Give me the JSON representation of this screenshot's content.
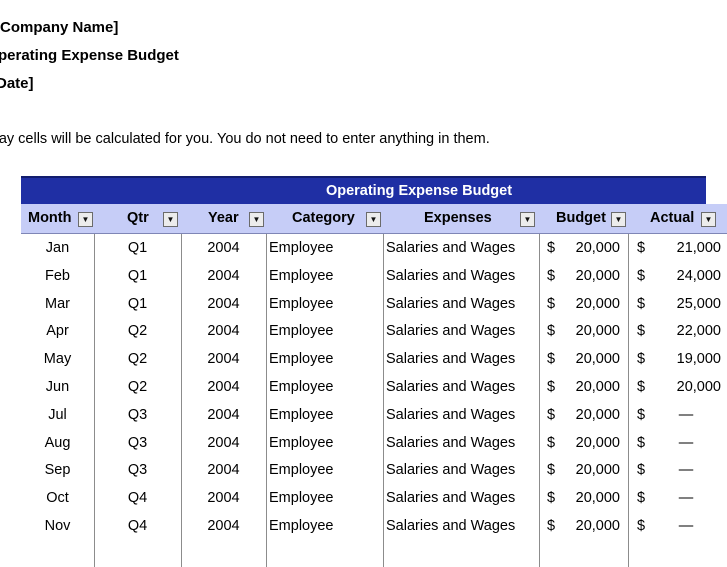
{
  "header": {
    "company": "Company Name]",
    "title": "perating Expense Budget",
    "date": "Date]"
  },
  "note": "ray cells will be calculated for you. You do not need to enter anything in them.",
  "table": {
    "banner": "Operating Expense Budget",
    "columns": [
      {
        "label": "Month",
        "dropdown": "▼"
      },
      {
        "label": "Qtr",
        "dropdown": "▼"
      },
      {
        "label": "Year",
        "dropdown": "▼"
      },
      {
        "label": "Category",
        "dropdown": "▼"
      },
      {
        "label": "Expenses",
        "dropdown": "▼"
      },
      {
        "label": "Budget",
        "dropdown": "▼"
      },
      {
        "label": "Actual",
        "dropdown": "▼"
      }
    ],
    "currency_symbol": "$",
    "rows": [
      {
        "month": "Jan",
        "qtr": "Q1",
        "year": "2004",
        "category": "Employee",
        "expenses": "Salaries and Wages",
        "budget": "20,000",
        "actual": "21,000"
      },
      {
        "month": "Feb",
        "qtr": "Q1",
        "year": "2004",
        "category": "Employee",
        "expenses": "Salaries and Wages",
        "budget": "20,000",
        "actual": "24,000"
      },
      {
        "month": "Mar",
        "qtr": "Q1",
        "year": "2004",
        "category": "Employee",
        "expenses": "Salaries and Wages",
        "budget": "20,000",
        "actual": "25,000"
      },
      {
        "month": "Apr",
        "qtr": "Q2",
        "year": "2004",
        "category": "Employee",
        "expenses": "Salaries and Wages",
        "budget": "20,000",
        "actual": "22,000"
      },
      {
        "month": "May",
        "qtr": "Q2",
        "year": "2004",
        "category": "Employee",
        "expenses": "Salaries and Wages",
        "budget": "20,000",
        "actual": "19,000"
      },
      {
        "month": "Jun",
        "qtr": "Q2",
        "year": "2004",
        "category": "Employee",
        "expenses": "Salaries and Wages",
        "budget": "20,000",
        "actual": "20,000"
      },
      {
        "month": "Jul",
        "qtr": "Q3",
        "year": "2004",
        "category": "Employee",
        "expenses": "Salaries and Wages",
        "budget": "20,000",
        "actual": "—"
      },
      {
        "month": "Aug",
        "qtr": "Q3",
        "year": "2004",
        "category": "Employee",
        "expenses": "Salaries and Wages",
        "budget": "20,000",
        "actual": "—"
      },
      {
        "month": "Sep",
        "qtr": "Q3",
        "year": "2004",
        "category": "Employee",
        "expenses": "Salaries and Wages",
        "budget": "20,000",
        "actual": "—"
      },
      {
        "month": "Oct",
        "qtr": "Q4",
        "year": "2004",
        "category": "Employee",
        "expenses": "Salaries and Wages",
        "budget": "20,000",
        "actual": "—"
      },
      {
        "month": "Nov",
        "qtr": "Q4",
        "year": "2004",
        "category": "Employee",
        "expenses": "Salaries and Wages",
        "budget": "20,000",
        "actual": "—"
      }
    ]
  },
  "colors": {
    "banner": "#1f2fa4",
    "header_row": "#c6cdf7"
  }
}
